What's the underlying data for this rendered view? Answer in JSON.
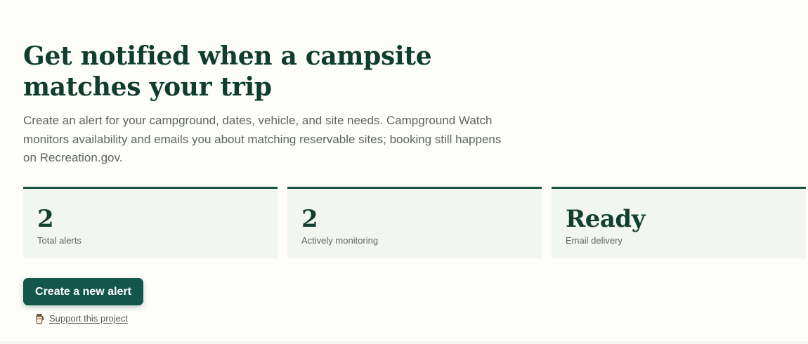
{
  "hero": {
    "title": "Get notified when a campsite matches your trip",
    "description": "Create an alert for your campground, dates, vehicle, and site needs. Campground Watch monitors availability and emails you about matching reservable sites; booking still happens on Recreation.gov."
  },
  "stats": [
    {
      "value": "2",
      "label": "Total alerts"
    },
    {
      "value": "2",
      "label": "Actively monitoring"
    },
    {
      "value": "Ready",
      "label": "Email delivery"
    }
  ],
  "actions": {
    "create_label": "Create a new alert",
    "support_label": "Support this project",
    "support_icon": "coffee-cup-icon"
  },
  "colors": {
    "accent": "#12574a",
    "heading": "#0f3d2f",
    "card_background": "#f2f6f1",
    "card_border": "#175543",
    "page_background": "#fdfdf9"
  }
}
